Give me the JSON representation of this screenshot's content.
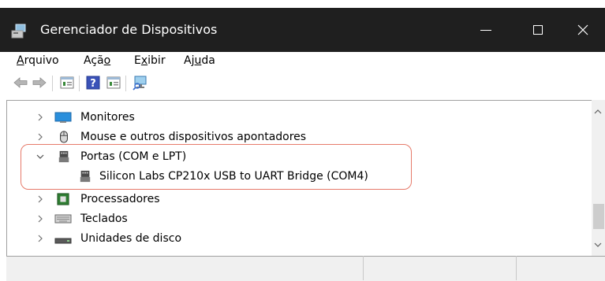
{
  "window": {
    "title": "Gerenciador de Dispositivos",
    "icon": "device-manager-icon",
    "controls": [
      "minimize-icon",
      "maximize-icon",
      "close-icon"
    ]
  },
  "menu": {
    "items": [
      {
        "label": "Arquivo",
        "accel": "A"
      },
      {
        "label": "Ação",
        "accel": "o"
      },
      {
        "label": "Exibir",
        "accel": "x"
      },
      {
        "label": "Ajuda",
        "accel": "u"
      }
    ]
  },
  "toolbar": {
    "buttons": [
      "back-arrow-icon",
      "forward-arrow-icon",
      "properties-icon",
      "help-icon",
      "console-tree-icon",
      "scan-hardware-icon"
    ]
  },
  "tree": {
    "items": [
      {
        "label": "Monitores",
        "expanded": false,
        "icon": "monitor-icon"
      },
      {
        "label": "Mouse e outros dispositivos apontadores",
        "expanded": false,
        "icon": "mouse-icon"
      },
      {
        "label": "Portas (COM e LPT)",
        "expanded": true,
        "icon": "port-icon"
      },
      {
        "label": "Silicon Labs CP210x USB to UART Bridge (COM4)",
        "child": true,
        "icon": "port-icon"
      },
      {
        "label": "Processadores",
        "expanded": false,
        "icon": "processor-icon"
      },
      {
        "label": "Teclados",
        "expanded": false,
        "icon": "keyboard-icon"
      },
      {
        "label": "Unidades de disco",
        "expanded": false,
        "icon": "disk-drive-icon"
      }
    ]
  },
  "colors": {
    "titlebar": "#1f1f1f",
    "highlight": "#e67a6a"
  }
}
